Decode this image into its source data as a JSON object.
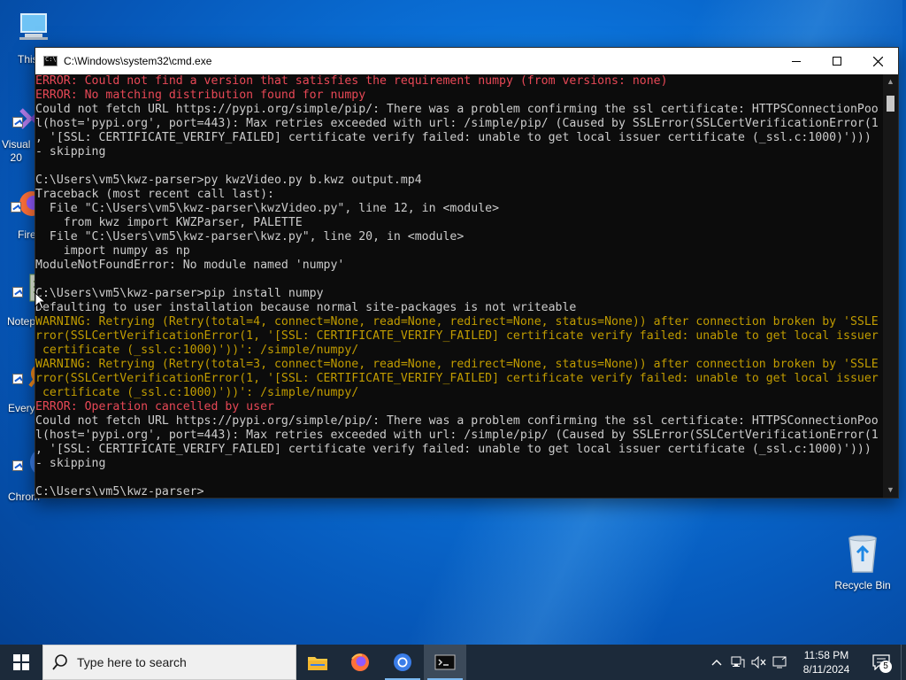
{
  "desktop": {
    "icons": [
      {
        "label": "This"
      },
      {
        "label": "Visual\n20"
      },
      {
        "label": "Fire"
      },
      {
        "label": "Notep"
      },
      {
        "label": "Every"
      },
      {
        "label": "Chrom"
      }
    ],
    "recycle_bin": {
      "label": "Recycle Bin"
    }
  },
  "window": {
    "title": "C:\\Windows\\system32\\cmd.exe",
    "minimize_icon": "minimize-icon",
    "maximize_icon": "maximize-icon",
    "close_icon": "close-icon",
    "lines": [
      {
        "kind": "error",
        "text": "ERROR: Could not find a version that satisfies the requirement numpy (from versions: none)"
      },
      {
        "kind": "error",
        "text": "ERROR: No matching distribution found for numpy"
      },
      {
        "kind": "normal",
        "text": "Could not fetch URL https://pypi.org/simple/pip/: There was a problem confirming the ssl certificate: HTTPSConnectionPoo"
      },
      {
        "kind": "normal",
        "text": "l(host='pypi.org', port=443): Max retries exceeded with url: /simple/pip/ (Caused by SSLError(SSLCertVerificationError(1"
      },
      {
        "kind": "normal",
        "text": ", '[SSL: CERTIFICATE_VERIFY_FAILED] certificate verify failed: unable to get local issuer certificate (_ssl.c:1000)')))"
      },
      {
        "kind": "normal",
        "text": "- skipping"
      },
      {
        "kind": "normal",
        "text": ""
      },
      {
        "kind": "normal",
        "text": "C:\\Users\\vm5\\kwz-parser>py kwzVideo.py b.kwz output.mp4"
      },
      {
        "kind": "normal",
        "text": "Traceback (most recent call last):"
      },
      {
        "kind": "normal",
        "text": "  File \"C:\\Users\\vm5\\kwz-parser\\kwzVideo.py\", line 12, in <module>"
      },
      {
        "kind": "normal",
        "text": "    from kwz import KWZParser, PALETTE"
      },
      {
        "kind": "normal",
        "text": "  File \"C:\\Users\\vm5\\kwz-parser\\kwz.py\", line 20, in <module>"
      },
      {
        "kind": "normal",
        "text": "    import numpy as np"
      },
      {
        "kind": "normal",
        "text": "ModuleNotFoundError: No module named 'numpy'"
      },
      {
        "kind": "normal",
        "text": ""
      },
      {
        "kind": "normal",
        "text": "C:\\Users\\vm5\\kwz-parser>pip install numpy"
      },
      {
        "kind": "normal",
        "text": "Defaulting to user installation because normal site-packages is not writeable"
      },
      {
        "kind": "warning",
        "text": "WARNING: Retrying (Retry(total=4, connect=None, read=None, redirect=None, status=None)) after connection broken by 'SSLE"
      },
      {
        "kind": "warning",
        "text": "rror(SSLCertVerificationError(1, '[SSL: CERTIFICATE_VERIFY_FAILED] certificate verify failed: unable to get local issuer"
      },
      {
        "kind": "warning",
        "text": " certificate (_ssl.c:1000)'))': /simple/numpy/"
      },
      {
        "kind": "warning",
        "text": "WARNING: Retrying (Retry(total=3, connect=None, read=None, redirect=None, status=None)) after connection broken by 'SSLE"
      },
      {
        "kind": "warning",
        "text": "rror(SSLCertVerificationError(1, '[SSL: CERTIFICATE_VERIFY_FAILED] certificate verify failed: unable to get local issuer"
      },
      {
        "kind": "warning",
        "text": " certificate (_ssl.c:1000)'))': /simple/numpy/"
      },
      {
        "kind": "error",
        "text": "ERROR: Operation cancelled by user"
      },
      {
        "kind": "normal",
        "text": "Could not fetch URL https://pypi.org/simple/pip/: There was a problem confirming the ssl certificate: HTTPSConnectionPoo"
      },
      {
        "kind": "normal",
        "text": "l(host='pypi.org', port=443): Max retries exceeded with url: /simple/pip/ (Caused by SSLError(SSLCertVerificationError(1"
      },
      {
        "kind": "normal",
        "text": ", '[SSL: CERTIFICATE_VERIFY_FAILED] certificate verify failed: unable to get local issuer certificate (_ssl.c:1000)')))"
      },
      {
        "kind": "normal",
        "text": "- skipping"
      },
      {
        "kind": "normal",
        "text": ""
      },
      {
        "kind": "normal",
        "text": "C:\\Users\\vm5\\kwz-parser>"
      }
    ]
  },
  "taskbar": {
    "search_placeholder": "Type here to search",
    "apps": [
      "file-explorer-icon",
      "firefox-icon",
      "chrome-icon",
      "terminal-icon"
    ],
    "time": "11:58 PM",
    "date": "8/11/2024",
    "notification_count": "5"
  },
  "colors": {
    "terminal_bg": "#0c0c0c",
    "terminal_text": "#cccccc",
    "error": "#e74856",
    "warning": "#c19c00",
    "taskbar": "#1c2a3a"
  }
}
